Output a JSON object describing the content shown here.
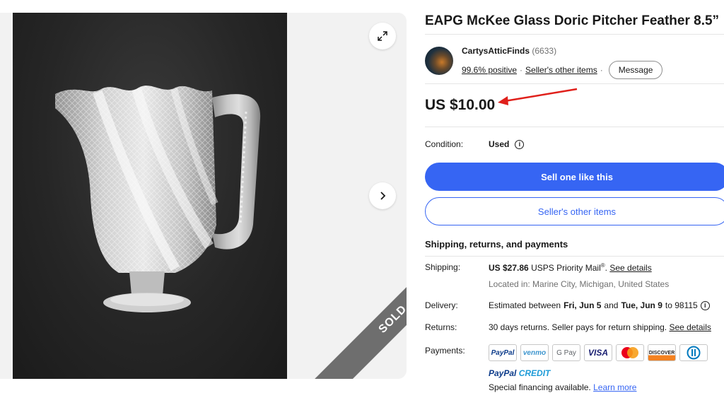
{
  "listing": {
    "title": "EAPG McKee Glass Doric Pitcher Feather 8.5”",
    "sold_label": "SOLD",
    "price": "US $10.00"
  },
  "seller": {
    "name": "CartysAtticFinds",
    "feedback_count": "(6633)",
    "positive": "99.6% positive",
    "separator": "·",
    "other_items_link": "Seller's other items",
    "message_button": "Message"
  },
  "condition": {
    "label": "Condition:",
    "value": "Used",
    "info_icon": "i"
  },
  "actions": {
    "sell_one_like_this": "Sell one like this",
    "sellers_other_items": "Seller's other items"
  },
  "shipping_section": {
    "title": "Shipping, returns, and payments",
    "shipping_label": "Shipping:",
    "shipping_price": "US $27.86",
    "shipping_service": "USPS Priority Mail",
    "shipping_registered": "®",
    "shipping_period": ".",
    "see_details": "See details",
    "located_in": "Located in: Marine City, Michigan, United States",
    "delivery_label": "Delivery:",
    "delivery_prefix": "Estimated between",
    "delivery_start": "Fri, Jun 5",
    "delivery_and": "and",
    "delivery_end": "Tue, Jun 9",
    "delivery_to": "to 98115",
    "returns_label": "Returns:",
    "returns_text": "30 days returns. Seller pays for return shipping.",
    "returns_link": "See details",
    "payments_label": "Payments:",
    "payment_methods": [
      "PayPal",
      "venmo",
      "G Pay",
      "VISA",
      "Mastercard",
      "DISCOVER",
      "Diners Club"
    ],
    "paypal_credit_a": "PayPal",
    "paypal_credit_b": "CREDIT",
    "financing_text": "Special financing available.",
    "learn_more": "Learn more"
  },
  "icons": {
    "expand": "expand-icon",
    "next": "chevron-right-icon",
    "info": "info-icon",
    "annotation_arrow": "red-arrow-icon"
  },
  "colors": {
    "primary": "#3665f3",
    "annotation": "#e0201b",
    "sold_band": "#6e6e6e"
  }
}
